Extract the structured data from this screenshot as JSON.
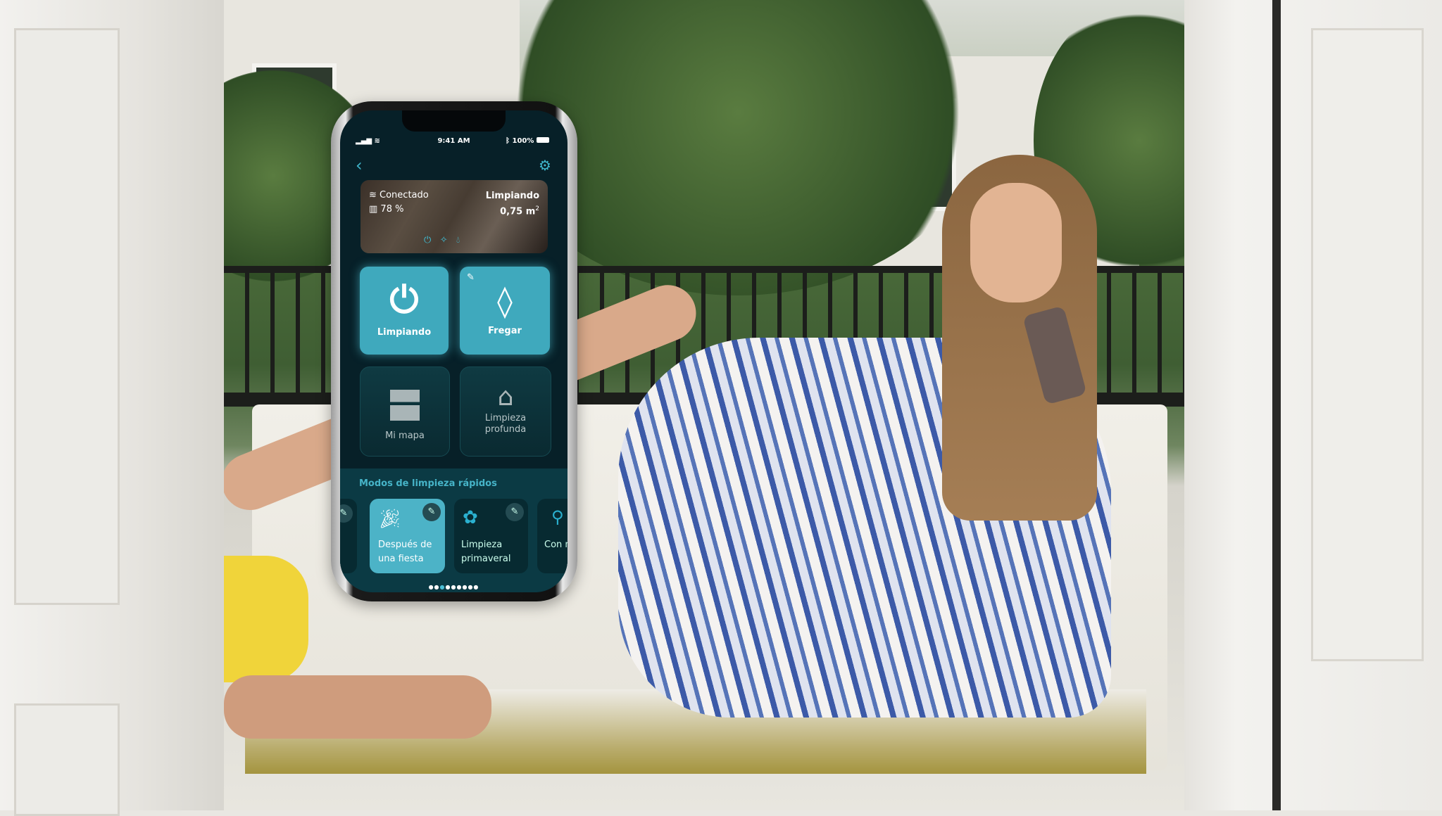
{
  "status_bar": {
    "time": "9:41 AM",
    "battery": "100%"
  },
  "banner": {
    "connection": "Conectado",
    "battery": "78 %",
    "state": "Limpiando",
    "area": "0,75 m",
    "area_unit_sup": "2"
  },
  "actions": [
    {
      "label": "Limpiando",
      "icon": "power-icon",
      "active": true
    },
    {
      "label": "Fregar",
      "icon": "water-drop-icon",
      "active": true
    },
    {
      "label": "Mi mapa",
      "icon": "map-icon",
      "active": false
    },
    {
      "label": "Limpieza profunda",
      "icon": "sparkle-house-icon",
      "active": false
    }
  ],
  "quick_modes": {
    "title": "Modos de limpieza rápidos",
    "items": [
      {
        "label": "Después de una fiesta",
        "icon": "party-popper-icon",
        "active": true
      },
      {
        "label": "Limpieza primaveral",
        "icon": "flower-icon",
        "active": false
      },
      {
        "label": "Con mar",
        "icon": "mop-icon",
        "active": false
      }
    ],
    "page_count": 9,
    "current_page": 3
  },
  "colors": {
    "accent": "#3fa9bd",
    "screen_bg": "#072028",
    "section_bg": "#0b3a44"
  }
}
